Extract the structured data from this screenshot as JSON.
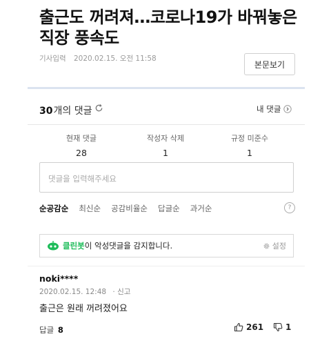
{
  "article": {
    "title": "출근도 꺼려져…코로나19가 바꿔놓은 직장 풍속도",
    "meta_label": "기사입력",
    "meta_date": "2020.02.15. 오전 11:58",
    "view_button": "본문보기"
  },
  "comments_header": {
    "count": "30",
    "count_unit": "개의 댓글",
    "my_comments": "내 댓글"
  },
  "stats": [
    {
      "label": "현재 댓글",
      "value": "28"
    },
    {
      "label": "작성자 삭제",
      "value": "1"
    },
    {
      "label": "규정 미준수",
      "value": "1"
    }
  ],
  "input": {
    "placeholder": "댓글을 입력해주세요"
  },
  "sort_tabs": [
    {
      "label": "순공감순",
      "active": true
    },
    {
      "label": "최신순"
    },
    {
      "label": "공감비율순"
    },
    {
      "label": "답글순"
    },
    {
      "label": "과거순"
    }
  ],
  "help": "?",
  "cleanbot": {
    "name": "클린봇",
    "text": "이 악성댓글을 감지합니다.",
    "settings": "설정",
    "color": "#1ebc5a"
  },
  "comment": {
    "nickname": "noki****",
    "date": "2020.02.15. 12:48",
    "report": "· 신고",
    "text": "출근은 원래 꺼려졌어요",
    "replies_label": "답글",
    "replies_count": "8",
    "likes": "261",
    "dislikes": "1"
  }
}
